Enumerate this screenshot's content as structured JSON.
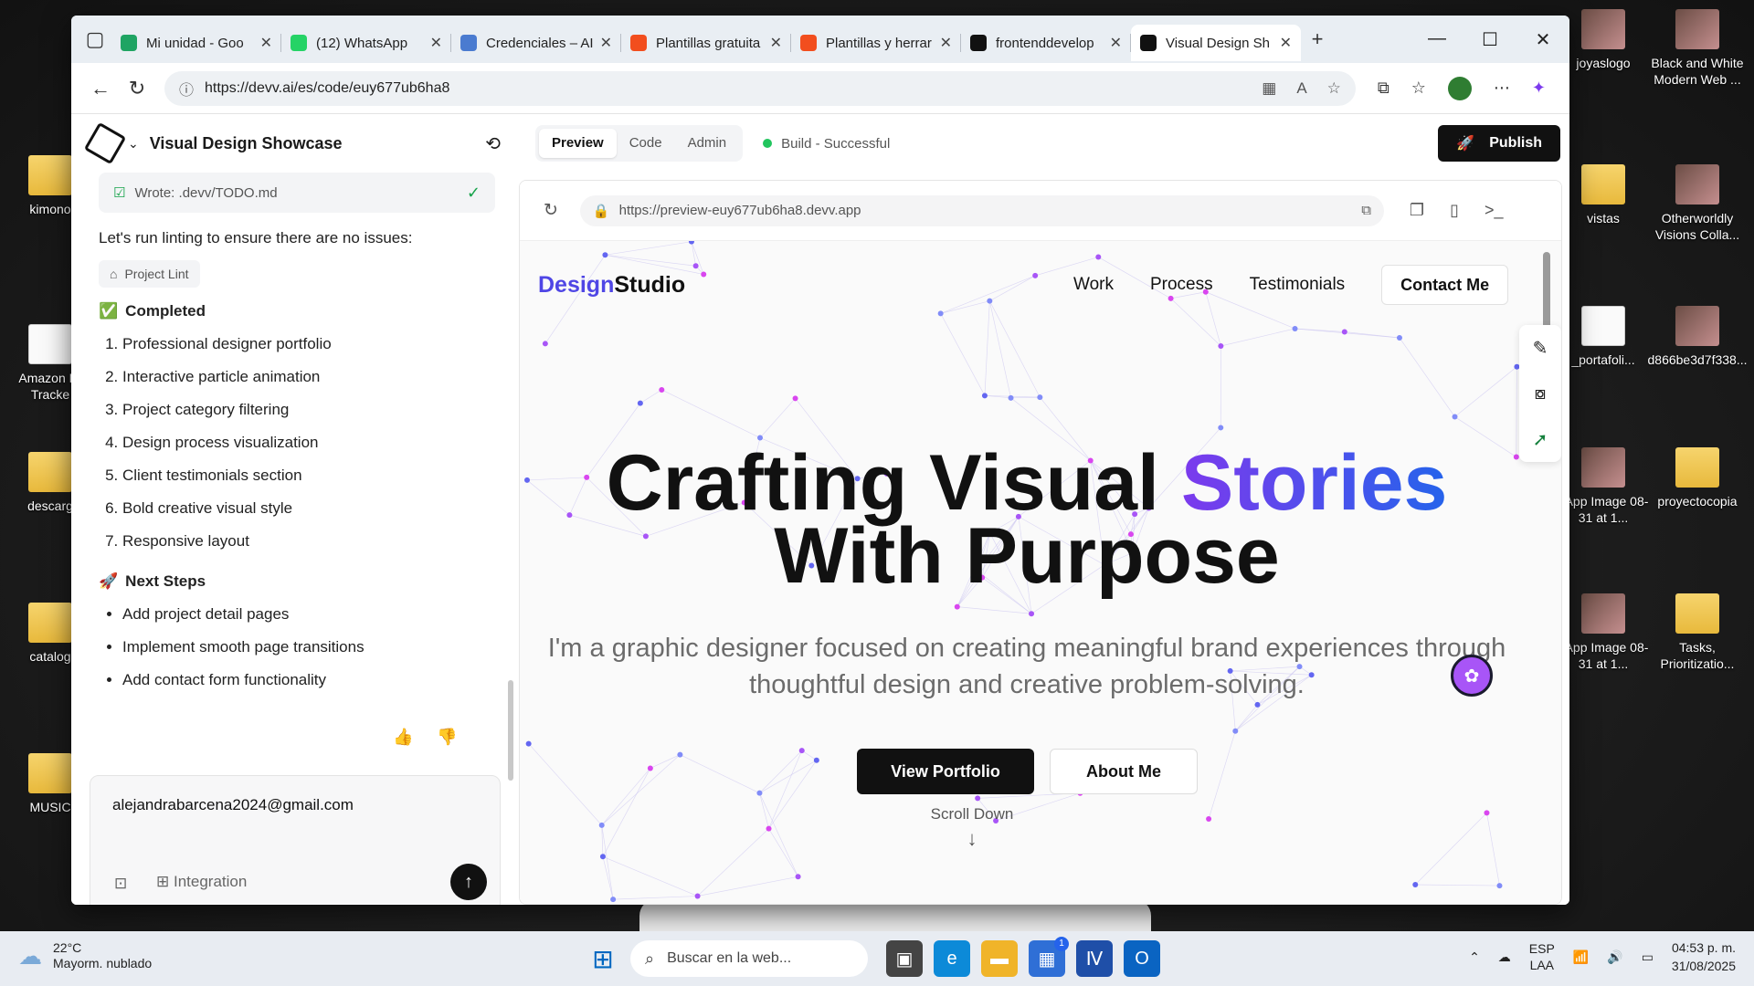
{
  "desktop": {
    "icons": [
      {
        "label": "kimono",
        "kind": "folder"
      },
      {
        "label": "Amazon Pr Tracke",
        "kind": "doc"
      },
      {
        "label": "descarg",
        "kind": "folder"
      },
      {
        "label": "catalog",
        "kind": "folder"
      },
      {
        "label": "MUSIC",
        "kind": "folder"
      },
      {
        "label": "joyaslogo",
        "kind": "img"
      },
      {
        "label": "Black and White Modern Web ...",
        "kind": "img"
      },
      {
        "label": "vistas",
        "kind": "folder"
      },
      {
        "label": "Otherworldly Visions Colla...",
        "kind": "img"
      },
      {
        "label": "_portafoli...",
        "kind": "doc"
      },
      {
        "label": "d866be3d7f338...",
        "kind": "img"
      },
      {
        "label": "sApp Image 08-31 at 1...",
        "kind": "img"
      },
      {
        "label": "proyectocopia",
        "kind": "folder"
      },
      {
        "label": "sApp Image 08-31 at 1...",
        "kind": "img"
      },
      {
        "label": "Tasks, Prioritizatio...",
        "kind": "folder"
      }
    ]
  },
  "browser": {
    "tabs": [
      {
        "label": "Mi unidad - Goo",
        "icon": "google-drive-icon",
        "color": "#1fa463"
      },
      {
        "label": "(12) WhatsApp",
        "icon": "whatsapp-icon",
        "color": "#25d366"
      },
      {
        "label": "Credenciales – AI",
        "icon": "api-icon",
        "color": "#4a7bd0"
      },
      {
        "label": "Plantillas gratuita",
        "icon": "figma-icon",
        "color": "#f24e1e"
      },
      {
        "label": "Plantillas y herrar",
        "icon": "figma-icon",
        "color": "#f24e1e"
      },
      {
        "label": "frontenddevelop",
        "icon": "github-icon",
        "color": "#111111"
      },
      {
        "label": "Visual Design Sh",
        "icon": "devv-icon",
        "color": "#111111",
        "active": true
      }
    ],
    "new_tab": "+",
    "url": "https://devv.ai/es/code/euy677ub6ha8"
  },
  "left": {
    "project_title": "Visual Design Showcase",
    "wrote_chip": "Wrote: .devv/TODO.md",
    "lint_message": "Let's run linting to ensure there are no issues:",
    "lint_chip": "Project Lint",
    "completed_heading": "Completed",
    "completed_items": [
      "Professional designer portfolio",
      "Interactive particle animation",
      "Project category filtering",
      "Design process visualization",
      "Client testimonials section",
      "Bold creative visual style",
      "Responsive layout"
    ],
    "next_heading": "Next Steps",
    "next_items": [
      "Add project detail pages",
      "Implement smooth page transitions",
      "Add contact form functionality"
    ],
    "input_value": "alejandrabarcena2024@gmail.com",
    "integration_label": "Integration"
  },
  "right": {
    "tabs": [
      "Preview",
      "Code",
      "Admin"
    ],
    "active_tab": "Preview",
    "build_status": "Build - Successful",
    "publish_label": "Publish",
    "preview_url": "https://preview-euy677ub6ha8.devv.app",
    "site": {
      "brand_a": "Design",
      "brand_b": "Studio",
      "nav": [
        "Work",
        "Process",
        "Testimonials"
      ],
      "contact": "Contact Me",
      "hero_line1_a": "Crafting Visual ",
      "hero_line1_b": "Stories",
      "hero_line2": "With Purpose",
      "subtitle": "I'm a graphic designer focused on creating meaningful brand experiences through thoughtful design and creative problem-solving.",
      "cta_primary": "View Portfolio",
      "cta_secondary": "About Me",
      "scroll": "Scroll Down"
    }
  },
  "taskbar": {
    "temperature": "22°C",
    "weather": "Mayorm. nublado",
    "search_placeholder": "Buscar en la web...",
    "lang_1": "ESP",
    "lang_2": "LAA",
    "time": "04:53 p. m.",
    "date": "31/08/2025",
    "badge": "1"
  }
}
